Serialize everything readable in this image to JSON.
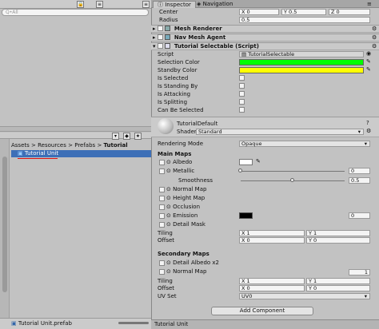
{
  "left_panel": {
    "search_placeholder": "Q•All",
    "breadcrumb": [
      "Assets",
      "Resources",
      "Prefabs",
      "Tutorial"
    ],
    "breadcrumb_sep": ">",
    "selected_asset": "Tutorial Unit",
    "bottom_status": "Tutorial Unit.prefab"
  },
  "tabs": [
    {
      "label": "Inspector",
      "active": true
    },
    {
      "label": "Navigation",
      "active": false
    }
  ],
  "top_fields": [
    {
      "label": "Center",
      "x": "X 0",
      "y": "Y 0.5",
      "z": "Z 0"
    },
    {
      "label": "Radius",
      "value": "0.5"
    }
  ],
  "components": {
    "mesh_renderer": "Mesh Renderer",
    "nav_mesh_agent": "Nav Mesh Agent",
    "tutorial_selectable": "Tutorial Selectable (Script)"
  },
  "script_props": {
    "script_label": "Script",
    "script_value": "TutorialSelectable",
    "selection_color_label": "Selection Color",
    "selection_color": "#00ff00",
    "standby_color_label": "Standby Color",
    "standby_color": "#ffff00",
    "bools": [
      "Is Selected",
      "Is Standing By",
      "Is Attacking",
      "Is Splitting",
      "Can Be Selected"
    ]
  },
  "material": {
    "name": "TutorialDefault",
    "shader_label": "Shader",
    "shader_value": "Standard",
    "rendering_mode_label": "Rendering Mode",
    "rendering_mode_value": "Opaque",
    "main_maps_title": "Main Maps",
    "albedo": "Albedo",
    "metallic": "Metallic",
    "metallic_value": "0",
    "smoothness": "Smoothness",
    "smoothness_value": "0.5",
    "normal_map": "Normal Map",
    "height_map": "Height Map",
    "occlusion": "Occlusion",
    "emission": "Emission",
    "emission_value": "0",
    "detail_mask": "Detail Mask",
    "tiling": "Tiling",
    "offset": "Offset",
    "tiling_x": "X 1",
    "tiling_y": "Y 1",
    "offset_x": "X 0",
    "offset_y": "Y 0",
    "secondary_title": "Secondary Maps",
    "detail_albedo": "Detail Albedo x2",
    "sec_normal_map": "Normal Map",
    "sec_normal_value": "1",
    "sec_tiling": "Tiling",
    "sec_offset": "Offset",
    "uv_set": "UV Set",
    "uv_set_value": "UV0"
  },
  "add_component": "Add Component",
  "bottom_label": "Tutorial Unit"
}
